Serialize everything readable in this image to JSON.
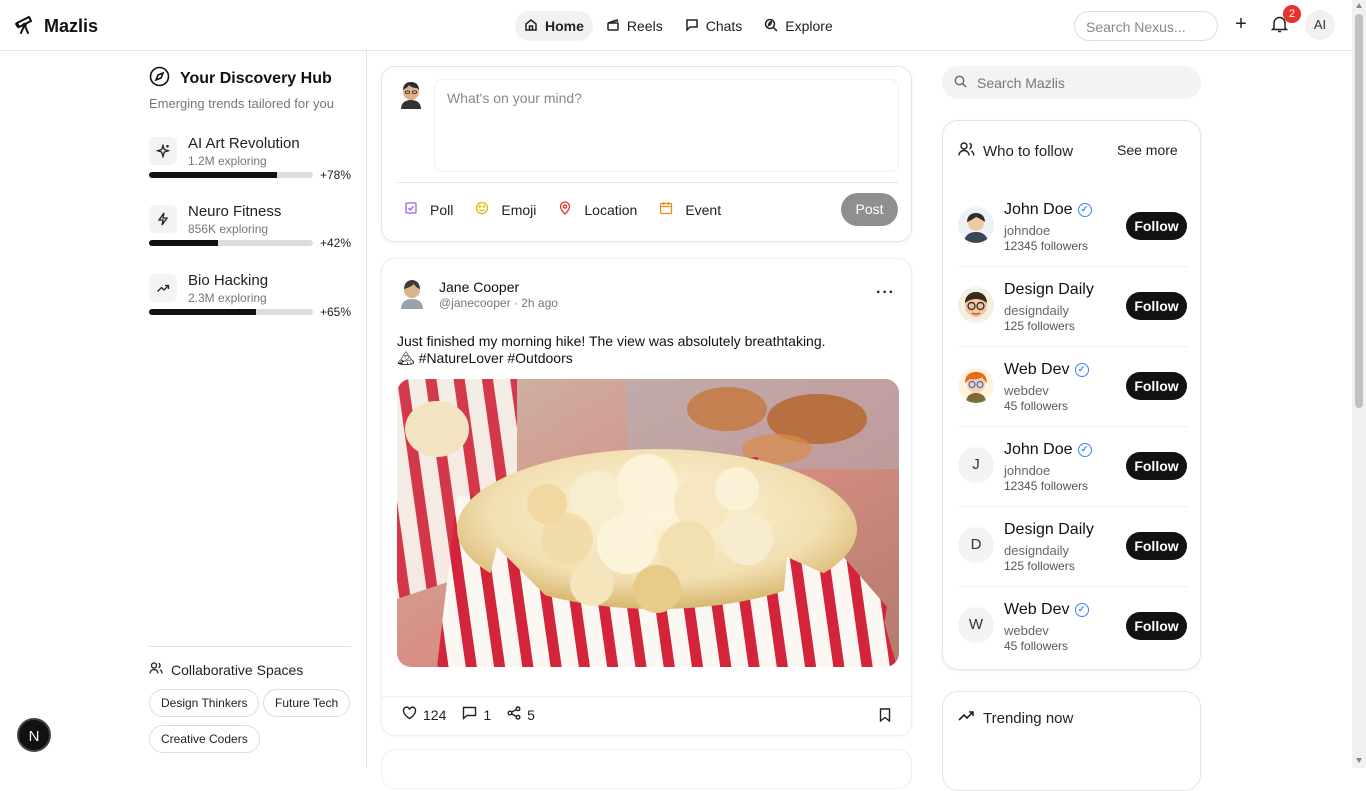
{
  "app": {
    "name": "Mazlis"
  },
  "nav": [
    {
      "label": "Home",
      "icon": "home-icon",
      "active": true
    },
    {
      "label": "Reels",
      "icon": "clapperboard-icon"
    },
    {
      "label": "Chats",
      "icon": "message-icon"
    },
    {
      "label": "Explore",
      "icon": "compass-search-icon"
    }
  ],
  "header": {
    "search_placeholder": "Search Nexus...",
    "notification_count": "2",
    "avatar_initials": "AI"
  },
  "left": {
    "hub_title": "Your Discovery Hub",
    "hub_subtitle": "Emerging trends tailored for you",
    "trends": [
      {
        "name": "AI Art Revolution",
        "count": "1.2M exploring",
        "pct": "+78%",
        "progress": 0.78
      },
      {
        "name": "Neuro Fitness",
        "count": "856K exploring",
        "pct": "+42%",
        "progress": 0.42
      },
      {
        "name": "Bio Hacking",
        "count": "2.3M exploring",
        "pct": "+65%",
        "progress": 0.65
      }
    ],
    "collab_title": "Collaborative Spaces",
    "spaces": [
      "Design Thinkers",
      "Future Tech",
      "Creative Coders"
    ],
    "next_badge": "N"
  },
  "composer": {
    "placeholder": "What's on your mind?",
    "actions": [
      "Poll",
      "Emoji",
      "Location",
      "Event"
    ],
    "post_label": "Post"
  },
  "post": {
    "name": "Jane Cooper",
    "handle": "@janecooper",
    "time": "2h ago",
    "text": "Just finished my morning hike! The view was absolutely breathtaking. 🏔 #NatureLover #Outdoors",
    "likes": "124",
    "comments": "1",
    "shares": "5"
  },
  "right": {
    "search_placeholder": "Search Mazlis",
    "who_to_follow": "Who to follow",
    "see_more": "See more",
    "suggestions": [
      {
        "name": "John Doe",
        "handle": "johndoe",
        "followers": "12345 followers",
        "verified": true,
        "initial": "",
        "follow": "Follow"
      },
      {
        "name": "Design Daily",
        "handle": "designdaily",
        "followers": "125 followers",
        "verified": false,
        "initial": "",
        "follow": "Follow"
      },
      {
        "name": "Web Dev",
        "handle": "webdev",
        "followers": "45 followers",
        "verified": true,
        "initial": "",
        "follow": "Follow"
      },
      {
        "name": "John Doe",
        "handle": "johndoe",
        "followers": "12345 followers",
        "verified": true,
        "initial": "J",
        "follow": "Follow"
      },
      {
        "name": "Design Daily",
        "handle": "designdaily",
        "followers": "125 followers",
        "verified": false,
        "initial": "D",
        "follow": "Follow"
      },
      {
        "name": "Web Dev",
        "handle": "webdev",
        "followers": "45 followers",
        "verified": true,
        "initial": "W",
        "follow": "Follow"
      }
    ],
    "trending_title": "Trending now"
  },
  "colors": {
    "accent": "#111111",
    "badge": "#e5322d",
    "verified": "#3b82f6",
    "post_disabled": "#8f8f8f"
  }
}
